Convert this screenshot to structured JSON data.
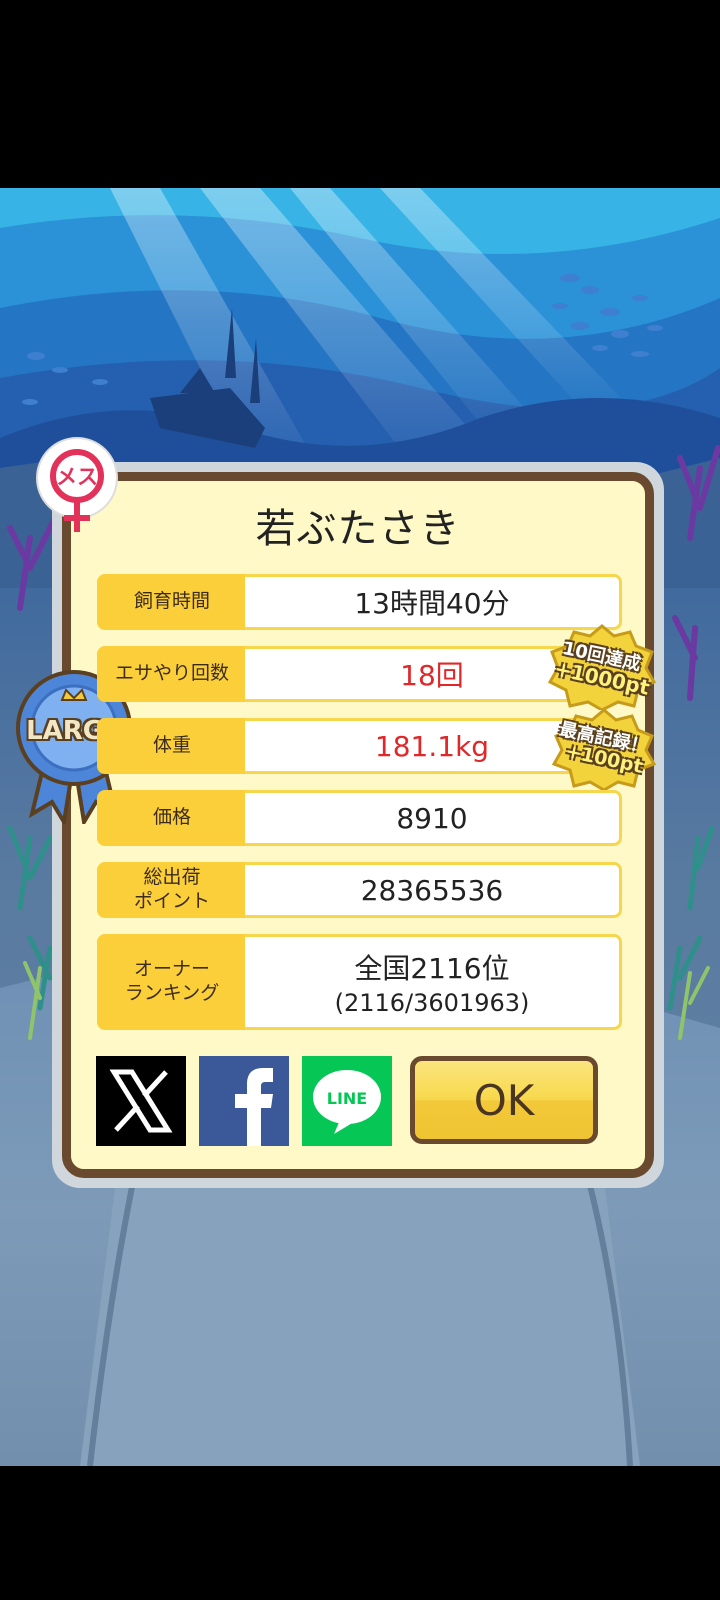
{
  "result": {
    "title": "若ぶたさき",
    "gender_badge": "メス",
    "size_badge": "LARGE",
    "rows": [
      {
        "label": "飼育時間",
        "value": "13時間40分"
      },
      {
        "label": "エサやり回数",
        "value": "18回"
      },
      {
        "label": "体重",
        "value": "181.1kg"
      },
      {
        "label": "価格",
        "value": "8910"
      },
      {
        "label": "総出荷\nポイント",
        "value": "28365536"
      },
      {
        "label": "オーナー\nランキング",
        "value": "全国2116位",
        "value_sub": "(2116/3601963)"
      }
    ],
    "bonuses": [
      {
        "title": "10回達成",
        "points": "+1000pt"
      },
      {
        "title": "最高記録！",
        "points": "+100pt"
      }
    ]
  },
  "share": {
    "x_icon": "x-logo-icon",
    "facebook_icon": "facebook-logo-icon",
    "line_icon": "line-logo-icon",
    "line_text": "LINE"
  },
  "ok_label": "OK",
  "colors": {
    "label_bg": "#fbcf3a",
    "panel_bg": "#fff9c8",
    "frame": "#6a4a2e",
    "highlight_red": "#e0282a",
    "facebook": "#3b5998",
    "line": "#06c755"
  }
}
